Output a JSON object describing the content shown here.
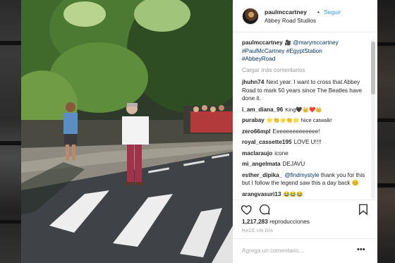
{
  "post": {
    "username": "paulmccartney",
    "separator": "•",
    "follow_label": "Seguir",
    "location": "Abbey Road Studios"
  },
  "caption": {
    "username": "paulmccartney",
    "emoji": "🎥",
    "mention": "@marymccartney",
    "hashtags_line1": "#PaulMcCartney #EgyptStation",
    "hashtags_line2": "#AbbeyRoad"
  },
  "load_more_label": "Cargar más comentarios",
  "comments": [
    {
      "user": "jhuhn74",
      "text": "Next year. I want to cross that Abbey Road to mark 50 years since The Beatles have done it."
    },
    {
      "user": "i_am_diana_96",
      "text": "King🖤👑❤️👑"
    },
    {
      "user": "purabay",
      "text": "🌟👏🌟👏🌟 Nice catwalk!"
    },
    {
      "user": "zero66mpl",
      "text": "Eeeeeeeeeeeeee!"
    },
    {
      "user": "royal_cassette195",
      "text": "LOVE U!!!!"
    },
    {
      "user": "maclaraujo",
      "text": "icone"
    },
    {
      "user": "mi_angelmata",
      "text": "DEJAVU"
    },
    {
      "user": "esther_dipika_",
      "mention": "@findmystyle",
      "text": "thank you for this but I follow the legend saw this a day back 😊"
    },
    {
      "user": "arangvasuri13",
      "text": "😂😂😂"
    }
  ],
  "stats": {
    "views_count": "1,217,283",
    "views_label": "reproducciones",
    "time_ago": "HACE UN DÍA"
  },
  "add_comment": {
    "placeholder": "Agrega un comentario...",
    "more": "•••"
  },
  "icons": {
    "like": "heart-icon",
    "comment": "comment-icon",
    "save": "bookmark-icon",
    "more": "more-options-icon"
  },
  "colors": {
    "follow": "#3897f0",
    "link": "#003569",
    "muted": "#999999"
  }
}
